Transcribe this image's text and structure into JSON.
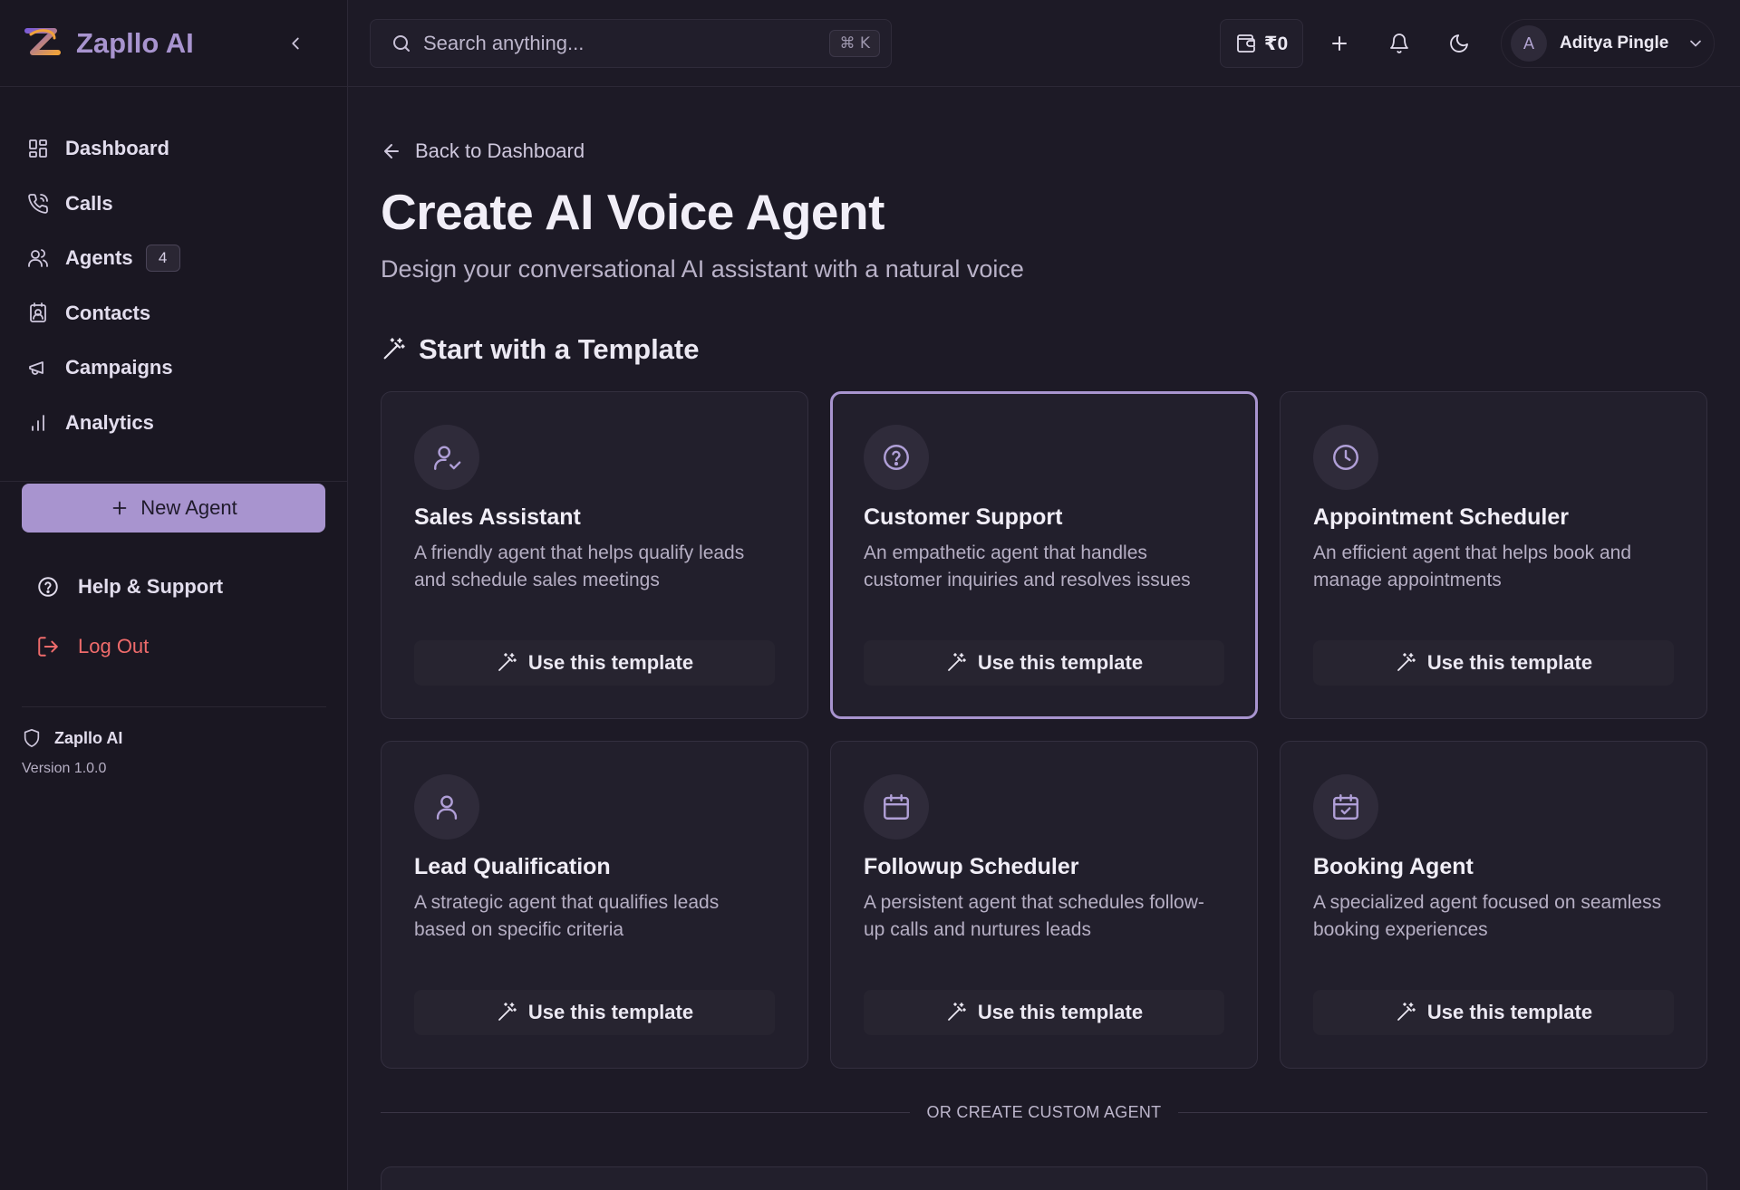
{
  "app": {
    "brand": "Zapllo AI",
    "version": "Version 1.0.0",
    "footer_brand": "Zapllo AI"
  },
  "sidebar": {
    "items": [
      {
        "label": "Dashboard",
        "icon": "dashboard-icon"
      },
      {
        "label": "Calls",
        "icon": "phone-icon"
      },
      {
        "label": "Agents",
        "icon": "users-icon",
        "badge": "4"
      },
      {
        "label": "Contacts",
        "icon": "contact-book-icon"
      },
      {
        "label": "Campaigns",
        "icon": "megaphone-icon"
      },
      {
        "label": "Analytics",
        "icon": "bar-chart-icon"
      }
    ],
    "new_agent": "New Agent",
    "help": "Help & Support",
    "logout": "Log Out"
  },
  "topbar": {
    "search_placeholder": "Search anything...",
    "shortcut": "⌘ K",
    "balance": "₹0",
    "user": {
      "initial": "A",
      "name": "Aditya Pingle"
    }
  },
  "main": {
    "back": "Back to Dashboard",
    "title": "Create AI Voice Agent",
    "subtitle": "Design your conversational AI assistant with a natural voice",
    "section_title": "Start with a Template",
    "templates": [
      {
        "title": "Sales Assistant",
        "description": "A friendly agent that helps qualify leads and schedule sales meetings",
        "icon": "user-check-icon",
        "button": "Use this template",
        "selected": false
      },
      {
        "title": "Customer Support",
        "description": "An empathetic agent that handles customer inquiries and resolves issues",
        "icon": "help-circle-icon",
        "button": "Use this template",
        "selected": true
      },
      {
        "title": "Appointment Scheduler",
        "description": "An efficient agent that helps book and manage appointments",
        "icon": "clock-icon",
        "button": "Use this template",
        "selected": false
      },
      {
        "title": "Lead Qualification",
        "description": "A strategic agent that qualifies leads based on specific criteria",
        "icon": "user-icon",
        "button": "Use this template",
        "selected": false
      },
      {
        "title": "Followup Scheduler",
        "description": "A persistent agent that schedules follow-up calls and nurtures leads",
        "icon": "calendar-icon",
        "button": "Use this template",
        "selected": false
      },
      {
        "title": "Booking Agent",
        "description": "A specialized agent focused on seamless booking experiences",
        "icon": "calendar-check-icon",
        "button": "Use this template",
        "selected": false
      }
    ],
    "or_divider": "OR CREATE CUSTOM AGENT"
  },
  "colors": {
    "accent": "#a894cf",
    "background": "#1d1a26",
    "danger": "#ef6b6b"
  }
}
